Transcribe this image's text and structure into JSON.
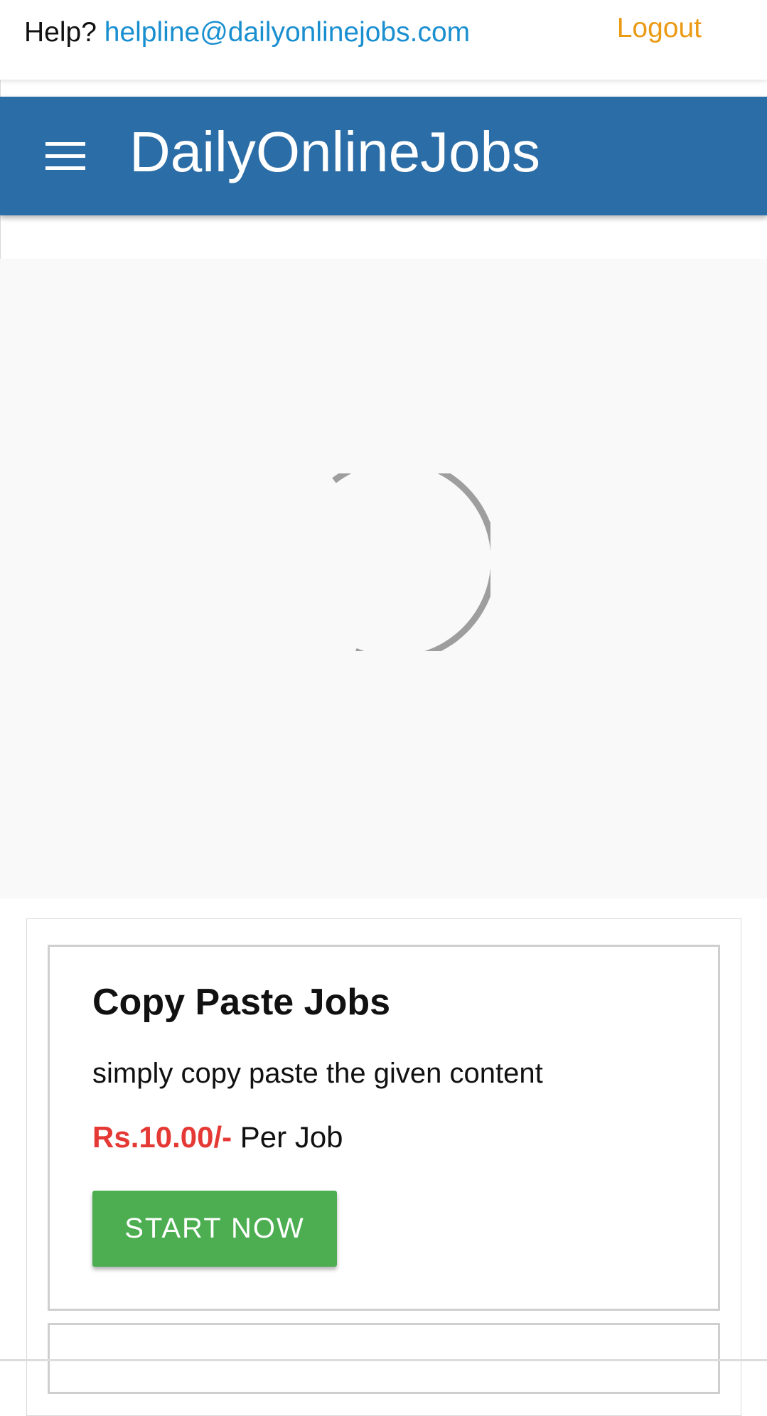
{
  "header": {
    "help_prefix": "Help?",
    "help_email": "helpline@dailyonlinejobs.com",
    "logout_label": "Logout"
  },
  "appbar": {
    "brand": "DailyOnlineJobs",
    "menu_icon": "hamburger-menu-icon"
  },
  "banner": {
    "state": "loading",
    "spinner_icon": "loading-spinner-icon"
  },
  "jobs": [
    {
      "title": "Copy Paste Jobs",
      "description": "simply copy paste the given content",
      "price": "Rs.10.00/-",
      "price_unit": "Per Job",
      "action_label": "START NOW"
    }
  ],
  "colors": {
    "appbar_bg": "#2b6da6",
    "link": "#1a8fd0",
    "logout": "#eb9a13",
    "price": "#e53935",
    "button": "#4cae50"
  }
}
